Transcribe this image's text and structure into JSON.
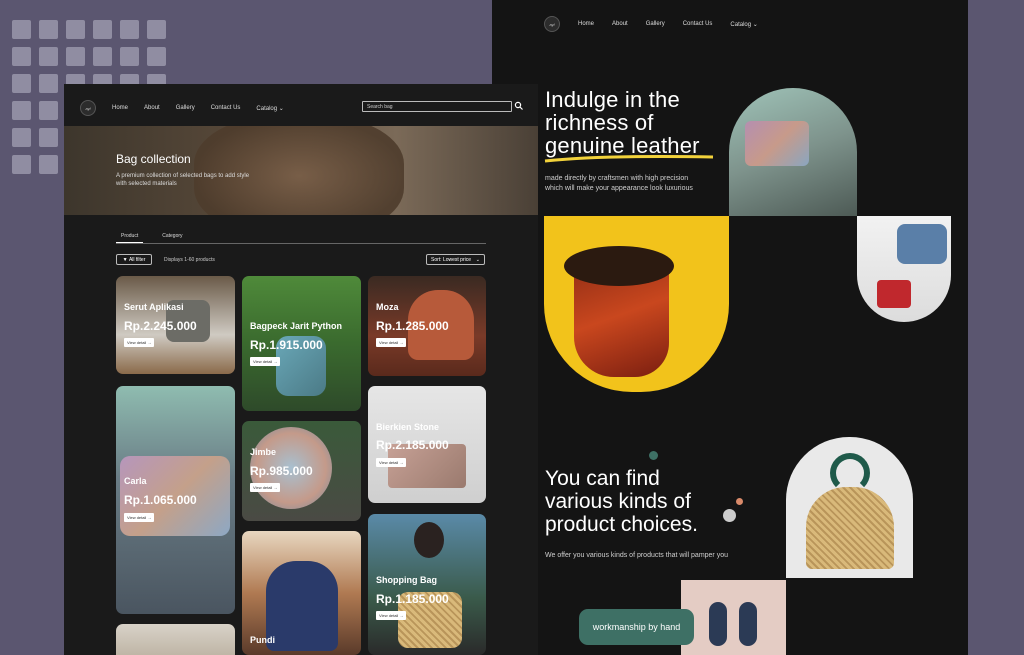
{
  "site2": {
    "nav": [
      "Home",
      "About",
      "Gallery",
      "Contact Us",
      "Catalog"
    ],
    "hero": {
      "line1": "Indulge in the",
      "line2": "richness of",
      "line3": "genuine leather",
      "sub": "made directly by craftsmen with high precision which will make your appearance look luxurious"
    },
    "section2": {
      "line1": "You can find",
      "line2": "various kinds of",
      "line3": "product choices.",
      "sub": "We offer you various kinds of products that will pamper you"
    },
    "pill": "workmanship by hand"
  },
  "site1": {
    "nav": [
      "Home",
      "About",
      "Gallery",
      "Contact Us",
      "Catalog"
    ],
    "search_placeholder": "Search bag",
    "banner": {
      "title": "Bag collection",
      "sub": "A premium collection of selected bags to add style with selected materials"
    },
    "tabs": [
      "Product",
      "Category"
    ],
    "filter": "All filter",
    "count": "Displays 1-60 products",
    "sort": "Sort: Lowest price",
    "view_detail": "View detail →",
    "products": [
      {
        "name": "Serut Aplikasi",
        "price": "Rp.2.245.000"
      },
      {
        "name": "Bagpeck Jarit Python",
        "price": "Rp.1.915.000"
      },
      {
        "name": "Moza",
        "price": "Rp.1.285.000"
      },
      {
        "name": "Carla",
        "price": "Rp.1.065.000"
      },
      {
        "name": "Jimbe",
        "price": "Rp.985.000"
      },
      {
        "name": "Bierkien Stone",
        "price": "Rp.2.185.000"
      },
      {
        "name": "Shopping Bag",
        "price": "Rp.1.185.000"
      },
      {
        "name": "Pundi",
        "price": ""
      }
    ]
  },
  "colors": {
    "bg": "#5b5670",
    "screen": "#141414",
    "accent_yellow": "#f2c31b",
    "accent_green": "#3e7065"
  }
}
